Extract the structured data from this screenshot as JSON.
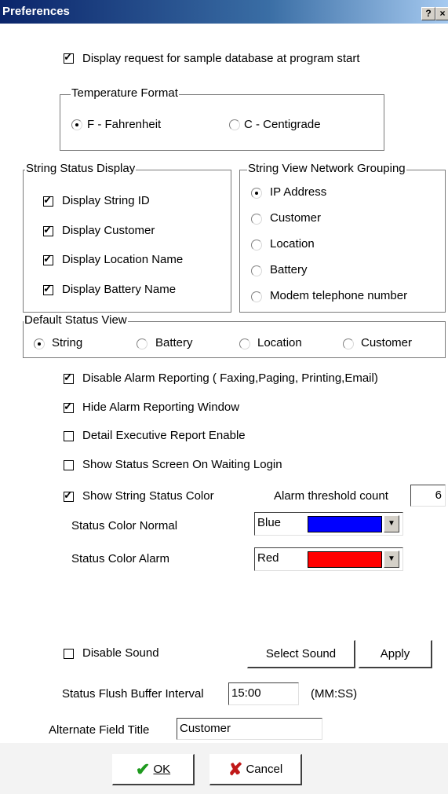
{
  "window": {
    "title": "Preferences",
    "help_btn": "?",
    "close_btn": "×"
  },
  "top": {
    "sample_db_label": "Display request for sample database at program start",
    "temperature": {
      "legend": "Temperature Format",
      "fahrenheit": "F - Fahrenheit",
      "centigrade": "C - Centigrade",
      "selected": "F"
    }
  },
  "string_status": {
    "legend": "String Status Display",
    "items": [
      {
        "label": "Display String ID",
        "checked": true
      },
      {
        "label": "Display Customer",
        "checked": true
      },
      {
        "label": "Display Location Name",
        "checked": true
      },
      {
        "label": "Display Battery Name",
        "checked": true
      }
    ]
  },
  "network_grouping": {
    "legend": "String View Network Grouping",
    "options": [
      "IP Address",
      "Customer",
      "Location",
      "Battery",
      "Modem telephone number"
    ],
    "selected": "IP Address"
  },
  "default_view": {
    "legend": "Default Status View",
    "options": [
      "String",
      "Battery",
      "Location",
      "Customer"
    ],
    "selected": "String"
  },
  "options": {
    "disable_alarm": "Disable Alarm Reporting ( Faxing,Paging, Printing,Email)",
    "hide_alarm": "Hide Alarm Reporting Window",
    "detail_exec": "Detail Executive Report Enable",
    "show_status_login": "Show Status Screen On Waiting Login",
    "show_string_color": "Show String Status Color",
    "alarm_threshold_label": "Alarm threshold count",
    "alarm_threshold_value": "6"
  },
  "colors": {
    "normal_label": "Status Color Normal",
    "normal_value": "Blue",
    "normal_swatch": "#0000ff",
    "alarm_label": "Status Color Alarm",
    "alarm_value": "Red",
    "alarm_swatch": "#ff0000"
  },
  "sound": {
    "disable_label": "Disable Sound",
    "select_btn": "Select Sound",
    "apply_btn": "Apply"
  },
  "flush": {
    "label": "Status Flush Buffer Interval",
    "value": "15:00",
    "unit": "(MM:SS)"
  },
  "alt_title": {
    "label": "Alternate Field Title",
    "value": "Customer"
  },
  "footer": {
    "ok": "OK",
    "cancel": "Cancel",
    "ok_color": "#1e9a1e",
    "cancel_color": "#c01818"
  }
}
